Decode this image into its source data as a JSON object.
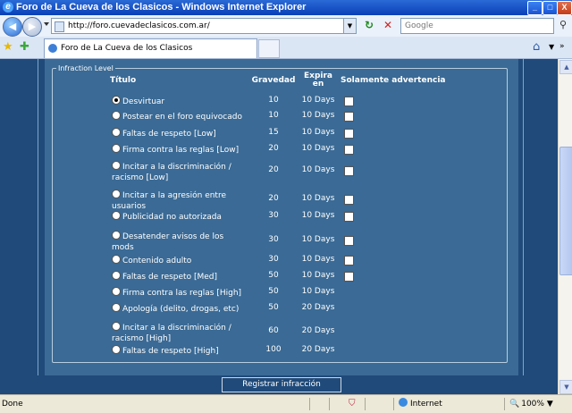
{
  "window": {
    "title": "Foro de La Cueva de los Clasicos - Windows Internet Explorer",
    "min_glyph": "_",
    "max_glyph": "□",
    "close_glyph": "X"
  },
  "address": {
    "url": "http://foro.cuevadeclasicos.com.ar/",
    "search_placeholder": "Google"
  },
  "tab": {
    "label": "Foro de La Cueva de los Clasicos"
  },
  "form": {
    "legend": "Infraction Level",
    "headers": {
      "titulo": "Título",
      "gravedad": "Gravedad",
      "expira_line1": "Expira",
      "expira_line2": "en",
      "advertencia": "Solamente advertencia"
    },
    "rows": [
      {
        "title": "Desvirtuar",
        "points": "10",
        "expires": "10 Days",
        "warning_box": true,
        "selected": true
      },
      {
        "title": "Postear en el foro equivocado",
        "points": "10",
        "expires": "10 Days",
        "warning_box": true,
        "selected": false
      },
      {
        "title": "Faltas de respeto [Low]",
        "points": "15",
        "expires": "10 Days",
        "warning_box": true,
        "selected": false
      },
      {
        "title": "Firma contra las reglas [Low]",
        "points": "20",
        "expires": "10 Days",
        "warning_box": true,
        "selected": false
      },
      {
        "title": "Incitar a la discriminación / racismo [Low]",
        "points": "20",
        "expires": "10 Days",
        "warning_box": true,
        "selected": false
      },
      {
        "title": "Incitar a la agresión entre usuarios",
        "points": "20",
        "expires": "10 Days",
        "warning_box": true,
        "selected": false
      },
      {
        "title": "Publicidad no autorizada",
        "points": "30",
        "expires": "10 Days",
        "warning_box": true,
        "selected": false
      },
      {
        "title": "Desatender avisos de los mods",
        "points": "30",
        "expires": "10 Days",
        "warning_box": true,
        "selected": false
      },
      {
        "title": "Contenido adulto",
        "points": "30",
        "expires": "10 Days",
        "warning_box": true,
        "selected": false
      },
      {
        "title": "Faltas de respeto [Med]",
        "points": "50",
        "expires": "10 Days",
        "warning_box": true,
        "selected": false
      },
      {
        "title": "Firma contra las reglas [High]",
        "points": "50",
        "expires": "10 Days",
        "warning_box": false,
        "selected": false
      },
      {
        "title": "Apología (delito, drogas, etc)",
        "points": "50",
        "expires": "20 Days",
        "warning_box": false,
        "selected": false
      },
      {
        "title": "Incitar a la discriminación / racismo [High]",
        "points": "60",
        "expires": "20 Days",
        "warning_box": false,
        "selected": false
      },
      {
        "title": "Faltas de respeto [High]",
        "points": "100",
        "expires": "20 Days",
        "warning_box": false,
        "selected": false
      }
    ],
    "submit_label": "Registrar infracción"
  },
  "status": {
    "text": "Done",
    "zone": "Internet",
    "zoom": "100%"
  }
}
